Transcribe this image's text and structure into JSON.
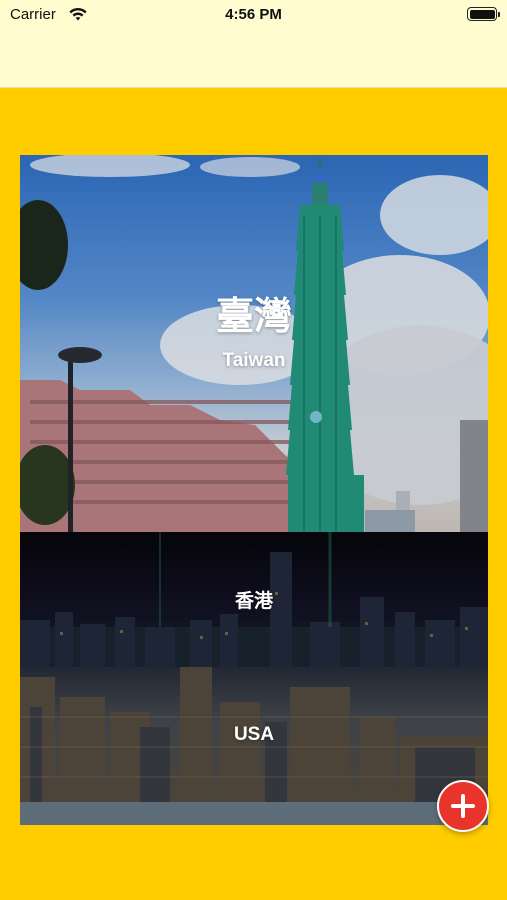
{
  "status_bar": {
    "carrier": "Carrier",
    "time": "4:56 PM",
    "battery_level": 1.0
  },
  "colors": {
    "nav_background": "#fffccf",
    "page_background": "#ffcc00",
    "fab_background": "#e8342a"
  },
  "regions": [
    {
      "title": "臺灣",
      "subtitle": "Taiwan"
    },
    {
      "title": "香港"
    },
    {
      "title": "USA"
    }
  ],
  "fab": {
    "icon": "plus-icon"
  }
}
